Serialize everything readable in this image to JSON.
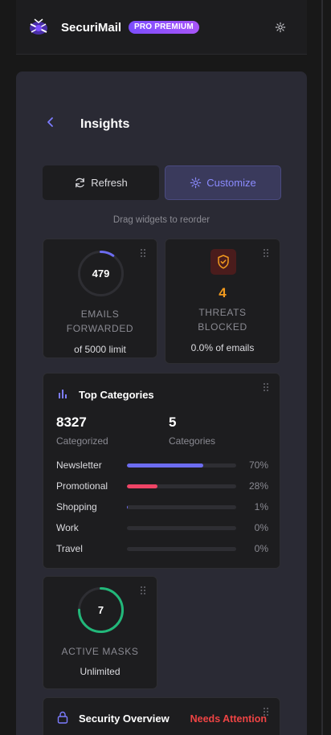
{
  "header": {
    "brand": "SecuriMail",
    "badge": "PRO PREMIUM",
    "settings_icon": "gear-icon"
  },
  "page": {
    "title": "Insights",
    "back_icon": "chevron-left-icon"
  },
  "toolbar": {
    "refresh_label": "Refresh",
    "customize_label": "Customize",
    "hint": "Drag widgets to reorder"
  },
  "widgets": {
    "emails_forwarded": {
      "value": "479",
      "label_line1": "EMAILS",
      "label_line2": "FORWARDED",
      "sub": "of 5000 limit",
      "progress": 0.0958
    },
    "threats_blocked": {
      "value": "4",
      "label_line1": "THREATS",
      "label_line2": "BLOCKED",
      "sub": "0.0% of emails"
    },
    "top_categories": {
      "title": "Top Categories",
      "categorized_value": "8327",
      "categorized_label": "Categorized",
      "categories_value": "5",
      "categories_label": "Categories",
      "rows": [
        {
          "name": "Newsletter",
          "pct": "70%",
          "fraction": 0.7,
          "color": "#6c6cf0"
        },
        {
          "name": "Promotional",
          "pct": "28%",
          "fraction": 0.28,
          "color": "#ef4466"
        },
        {
          "name": "Shopping",
          "pct": "1%",
          "fraction": 0.01,
          "color": "#6c6cf0"
        },
        {
          "name": "Work",
          "pct": "0%",
          "fraction": 0,
          "color": "#6c6cf0"
        },
        {
          "name": "Travel",
          "pct": "0%",
          "fraction": 0,
          "color": "#6c6cf0"
        }
      ]
    },
    "active_masks": {
      "value": "7",
      "label": "ACTIVE MASKS",
      "sub": "Unlimited",
      "progress": 0.75
    },
    "security_overview": {
      "title": "Security Overview",
      "status": "Needs Attention"
    }
  },
  "colors": {
    "accent": "#6c6cf0",
    "danger": "#ef4444",
    "warning": "#f29a1e",
    "success": "#22b87a"
  }
}
